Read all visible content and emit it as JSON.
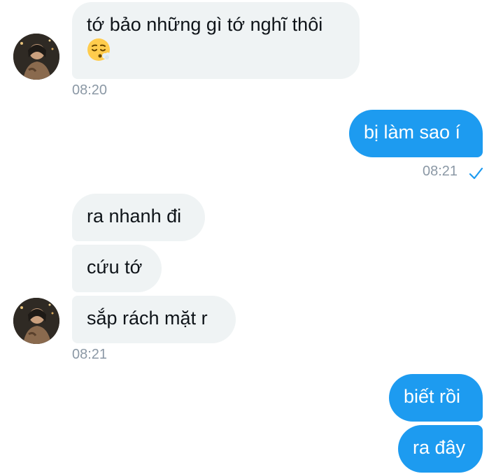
{
  "messages": [
    {
      "lines": [
        "tớ bảo những gì tớ nghĩ thôi"
      ],
      "emoji": "relieved-sigh-emoji",
      "time": "08:20"
    },
    {
      "text": "bị làm sao í",
      "time": "08:21"
    },
    {
      "text": "ra nhanh đi"
    },
    {
      "text": "cứu tớ"
    },
    {
      "text": "sắp rách mặt r",
      "time": "08:21"
    },
    {
      "text": "biết rồi"
    },
    {
      "text": "ra đây"
    }
  ],
  "colors": {
    "sent_bubble": "#1d9bf0",
    "received_bubble": "#eff3f4",
    "timestamp": "#8b98a5",
    "read_check": "#1d9bf0"
  },
  "icons": [
    "avatar",
    "relieved-sigh-emoji",
    "read-check-icon"
  ]
}
